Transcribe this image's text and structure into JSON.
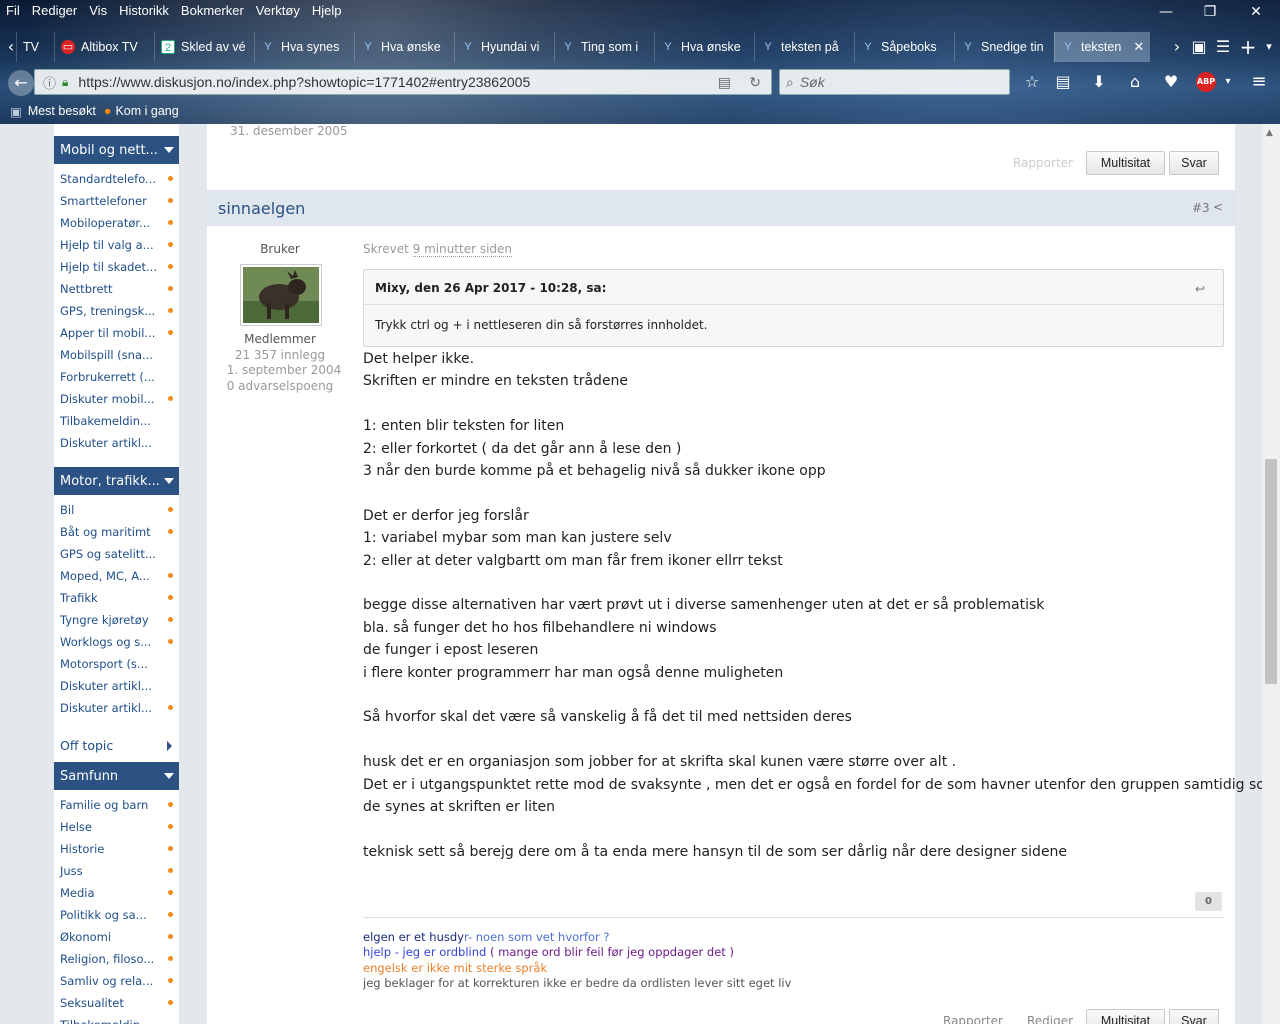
{
  "menu": [
    "Fil",
    "Rediger",
    "Vis",
    "Historikk",
    "Bokmerker",
    "Verktøy",
    "Hjelp"
  ],
  "tabs": [
    {
      "label": "TV"
    },
    {
      "label": "Altibox TV"
    },
    {
      "label": "Skled av vé"
    },
    {
      "label": "Hva synes"
    },
    {
      "label": "Hva ønske"
    },
    {
      "label": "Hyundai vi"
    },
    {
      "label": "Ting som i"
    },
    {
      "label": "Hva ønske"
    },
    {
      "label": "teksten på"
    },
    {
      "label": "Såpeboks"
    },
    {
      "label": "Snedige tin"
    },
    {
      "label": "teksten"
    }
  ],
  "url": "https://www.diskusjon.no/index.php?showtopic=1771402#entry23862005",
  "search_placeholder": "Søk",
  "bookmarks": [
    "Mest besøkt",
    "Kom i gang"
  ],
  "sidebar": {
    "sections": [
      {
        "title": "Mobil og nett...",
        "items": [
          {
            "label": "Standardtelefo...",
            "dot": true
          },
          {
            "label": "Smarttelefoner",
            "dot": true
          },
          {
            "label": "Mobiloperatør...",
            "dot": true
          },
          {
            "label": "Hjelp til valg a...",
            "dot": true
          },
          {
            "label": "Hjelp til skadet...",
            "dot": true
          },
          {
            "label": "Nettbrett",
            "dot": true
          },
          {
            "label": "GPS, treningsk...",
            "dot": true
          },
          {
            "label": "Apper til mobil...",
            "dot": true
          },
          {
            "label": "Mobilspill (sna...",
            "dot": false
          },
          {
            "label": "Forbrukerrett (...",
            "dot": false
          },
          {
            "label": "Diskuter mobil...",
            "dot": true
          },
          {
            "label": "Tilbakemeldin...",
            "dot": false
          },
          {
            "label": "Diskuter artikl...",
            "dot": false
          }
        ]
      },
      {
        "title": "Motor, trafikk...",
        "items": [
          {
            "label": "Bil",
            "dot": true
          },
          {
            "label": "Båt og maritimt",
            "dot": true
          },
          {
            "label": "GPS og satelitt...",
            "dot": false
          },
          {
            "label": "Moped, MC, A...",
            "dot": true
          },
          {
            "label": "Trafikk",
            "dot": true
          },
          {
            "label": "Tyngre kjøretøy",
            "dot": true
          },
          {
            "label": "Worklogs og s...",
            "dot": true
          },
          {
            "label": "Motorsport (s...",
            "dot": false
          },
          {
            "label": "Diskuter artikl...",
            "dot": false
          },
          {
            "label": "Diskuter artikl...",
            "dot": true
          }
        ]
      },
      {
        "title": "Samfunn",
        "items": [
          {
            "label": "Familie og barn",
            "dot": true
          },
          {
            "label": "Helse",
            "dot": true
          },
          {
            "label": "Historie",
            "dot": true
          },
          {
            "label": "Juss",
            "dot": true
          },
          {
            "label": "Media",
            "dot": true
          },
          {
            "label": "Politikk og sa...",
            "dot": true
          },
          {
            "label": "Økonomi",
            "dot": true
          },
          {
            "label": "Religion, filoso...",
            "dot": true
          },
          {
            "label": "Samliv og rela...",
            "dot": true
          },
          {
            "label": "Seksualitet",
            "dot": true
          },
          {
            "label": "Tilbakemeldin...",
            "dot": false
          }
        ]
      }
    ],
    "offtopic": "Off topic"
  },
  "prev_post": {
    "date": "31. desember 2005",
    "report": "Rapporter",
    "multiquote": "Multisitat",
    "reply": "Svar"
  },
  "post": {
    "username": "sinnaelgen",
    "number": "#3",
    "role": "Bruker",
    "group": "Medlemmer",
    "posts": "21 357 innlegg",
    "joined": "1. september 2004",
    "warnings": "0 advarselspoeng",
    "written_prefix": "Skrevet ",
    "written_time": "9 minutter siden",
    "quote_header": "Mixy, den 26 Apr 2017 - 10:28, sa:",
    "quote_text": "Trykk ctrl og + i nettleseren din så forstørres innholdet.",
    "lines": [
      "Det helper ikke.",
      "Skriften er mindre en teksten trådene",
      "",
      "1: enten blir teksten for liten",
      "2: eller forkortet ( da det går ann å lese den )",
      "3 når den burde komme på et behagelig nivå så dukker ikone opp",
      "",
      "Det er derfor jeg forslår",
      "1: variabel mybar som man kan justere selv",
      "2: eller at deter valgbartt om man får frem ikoner ellrr tekst",
      "",
      "begge disse alternativen har vært prøvt ut i diverse samenhenger uten at det er så problematisk",
      "bla. så funger det ho hos filbehandlere ni windows",
      "de funger i epost leseren",
      "i flere konter programmerr har man også denne muligheten",
      "",
      "Så hvorfor skal det være så vanskelig å få det til med nettsiden deres",
      "",
      "husk det er en organiasjon som jobber for at skrifta skal kunen være større over alt .",
      "Det er i utgangspunktet rette mod de svaksynte , men det er også en fordel for de som havner utenfor den gruppen samtidig som",
      "de synes at skriften er liten",
      "",
      "teknisk sett så berejg dere om å ta enda mere hansyn til de som ser dårlig når dere designer sidene"
    ],
    "rep": "0",
    "sig1_a": "elgen er et husdy",
    "sig1_b": "r- noen som vet hvorfor ?",
    "sig2_a": "hjelp - jeg er ordblind",
    "sig2_b": " ( mange ord blir feil før jeg oppdager det )",
    "sig3": "engelsk er ikke mit sterke språk",
    "sig4": "jeg beklager for at korrekturen ikke er bedre da ordlisten lever sitt eget liv",
    "footer_report": "Rapporter",
    "footer_edit": "Rediger",
    "footer_multiquote": "Multisitat",
    "footer_reply": "Svar"
  },
  "colors": {
    "accent": "#2b5283",
    "link": "#1f4e89",
    "dot": "#f08a1c",
    "userbar": "#e0e6ee"
  }
}
